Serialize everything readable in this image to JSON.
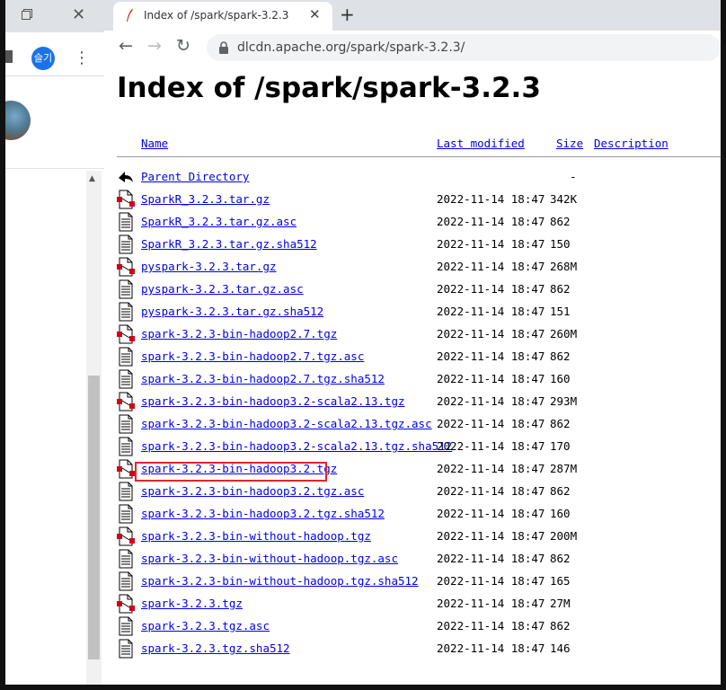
{
  "background_window": {
    "avatar_label": "슬기"
  },
  "tab": {
    "title": "Index of /spark/spark-3.2.3"
  },
  "address_bar": {
    "url": "dlcdn.apache.org/spark/spark-3.2.3/"
  },
  "page": {
    "heading": "Index of /spark/spark-3.2.3",
    "columns": {
      "name": "Name",
      "last_modified": "Last modified",
      "size": "Size",
      "description": "Description"
    },
    "parent": {
      "name": "Parent Directory",
      "size": "-"
    },
    "files": [
      {
        "name": "SparkR_3.2.3.tar.gz",
        "date": "2022-11-14 18:47",
        "size": "342K",
        "icon": "compressed-file-icon"
      },
      {
        "name": "SparkR_3.2.3.tar.gz.asc",
        "date": "2022-11-14 18:47",
        "size": "862",
        "icon": "text-file-icon"
      },
      {
        "name": "SparkR_3.2.3.tar.gz.sha512",
        "date": "2022-11-14 18:47",
        "size": "150",
        "icon": "text-file-icon"
      },
      {
        "name": "pyspark-3.2.3.tar.gz",
        "date": "2022-11-14 18:47",
        "size": "268M",
        "icon": "compressed-file-icon"
      },
      {
        "name": "pyspark-3.2.3.tar.gz.asc",
        "date": "2022-11-14 18:47",
        "size": "862",
        "icon": "text-file-icon"
      },
      {
        "name": "pyspark-3.2.3.tar.gz.sha512",
        "date": "2022-11-14 18:47",
        "size": "151",
        "icon": "text-file-icon"
      },
      {
        "name": "spark-3.2.3-bin-hadoop2.7.tgz",
        "date": "2022-11-14 18:47",
        "size": "260M",
        "icon": "compressed-file-icon"
      },
      {
        "name": "spark-3.2.3-bin-hadoop2.7.tgz.asc",
        "date": "2022-11-14 18:47",
        "size": "862",
        "icon": "text-file-icon"
      },
      {
        "name": "spark-3.2.3-bin-hadoop2.7.tgz.sha512",
        "date": "2022-11-14 18:47",
        "size": "160",
        "icon": "text-file-icon"
      },
      {
        "name": "spark-3.2.3-bin-hadoop3.2-scala2.13.tgz",
        "date": "2022-11-14 18:47",
        "size": "293M",
        "icon": "compressed-file-icon"
      },
      {
        "name": "spark-3.2.3-bin-hadoop3.2-scala2.13.tgz.asc",
        "date": "2022-11-14 18:47",
        "size": "862",
        "icon": "text-file-icon"
      },
      {
        "name": "spark-3.2.3-bin-hadoop3.2-scala2.13.tgz.sha512",
        "date": "2022-11-14 18:47",
        "size": "170",
        "icon": "text-file-icon"
      },
      {
        "name": "spark-3.2.3-bin-hadoop3.2.tgz",
        "date": "2022-11-14 18:47",
        "size": "287M",
        "icon": "compressed-file-icon",
        "highlighted": true
      },
      {
        "name": "spark-3.2.3-bin-hadoop3.2.tgz.asc",
        "date": "2022-11-14 18:47",
        "size": "862",
        "icon": "text-file-icon"
      },
      {
        "name": "spark-3.2.3-bin-hadoop3.2.tgz.sha512",
        "date": "2022-11-14 18:47",
        "size": "160",
        "icon": "text-file-icon"
      },
      {
        "name": "spark-3.2.3-bin-without-hadoop.tgz",
        "date": "2022-11-14 18:47",
        "size": "200M",
        "icon": "compressed-file-icon"
      },
      {
        "name": "spark-3.2.3-bin-without-hadoop.tgz.asc",
        "date": "2022-11-14 18:47",
        "size": "862",
        "icon": "text-file-icon"
      },
      {
        "name": "spark-3.2.3-bin-without-hadoop.tgz.sha512",
        "date": "2022-11-14 18:47",
        "size": "165",
        "icon": "text-file-icon"
      },
      {
        "name": "spark-3.2.3.tgz",
        "date": "2022-11-14 18:47",
        "size": "27M",
        "icon": "compressed-file-icon"
      },
      {
        "name": "spark-3.2.3.tgz.asc",
        "date": "2022-11-14 18:47",
        "size": "862",
        "icon": "text-file-icon"
      },
      {
        "name": "spark-3.2.3.tgz.sha512",
        "date": "2022-11-14 18:47",
        "size": "146",
        "icon": "text-file-icon"
      }
    ]
  },
  "colors": {
    "link": "#0000ee",
    "highlight_box": "#e0262c",
    "tabstrip": "#dee1e6"
  }
}
